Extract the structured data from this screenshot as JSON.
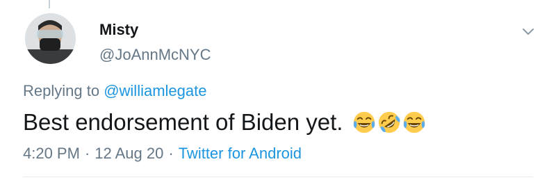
{
  "tweet": {
    "display_name": "Misty",
    "handle": "@JoAnnMcNYC",
    "replying_prefix": "Replying to",
    "replying_to": "@williamlegate",
    "text": "Best endorsement of Biden yet.",
    "emojis": [
      "face-with-tears-of-joy-icon",
      "rolling-on-floor-laughing-icon",
      "face-with-tears-of-joy-icon"
    ],
    "time": "4:20 PM",
    "date": "12 Aug 20",
    "source": "Twitter for Android",
    "separator": "·"
  },
  "colors": {
    "name": "#14171a",
    "secondary": "#657786",
    "link": "#1b95e0",
    "divider": "#e6ecf0",
    "emoji_yellow": "#ffcc4d"
  }
}
